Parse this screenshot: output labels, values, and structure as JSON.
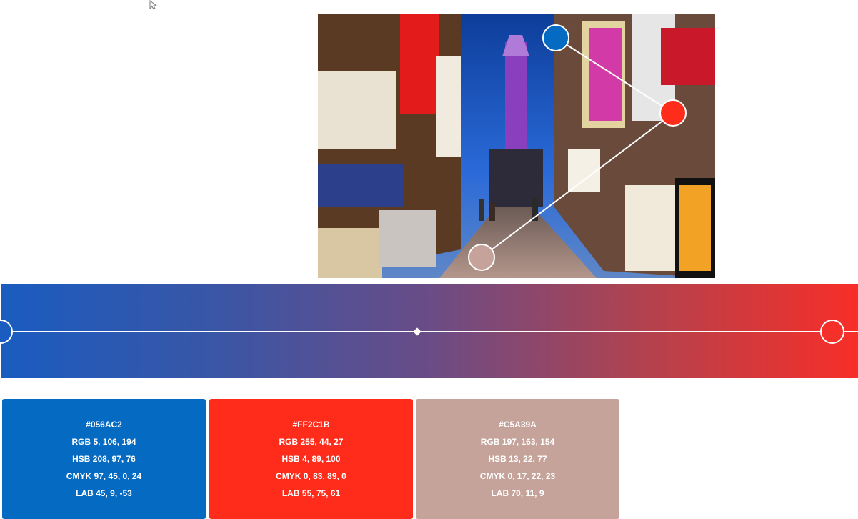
{
  "swatches": [
    {
      "hex": "#056AC2",
      "rgb": "RGB 5, 106, 194",
      "hsb": "HSB 208, 97, 76",
      "cmyk": "CMYK 97, 45, 0, 24",
      "lab": "LAB 45, 9, -53",
      "color": "#056AC2"
    },
    {
      "hex": "#FF2C1B",
      "rgb": "RGB 255, 44, 27",
      "hsb": "HSB 4, 89, 100",
      "cmyk": "CMYK 0, 83, 89, 0",
      "lab": "LAB 55, 75, 61",
      "color": "#FF2C1B"
    },
    {
      "hex": "#C5A39A",
      "rgb": "RGB 197, 163, 154",
      "hsb": "HSB 13, 22, 77",
      "cmyk": "CMYK 0, 17, 22, 23",
      "lab": "LAB 70, 11, 9",
      "color": "#C5A39A"
    }
  ],
  "gradient": {
    "start_color": "#056AC2",
    "end_color": "#FF2C1B"
  }
}
